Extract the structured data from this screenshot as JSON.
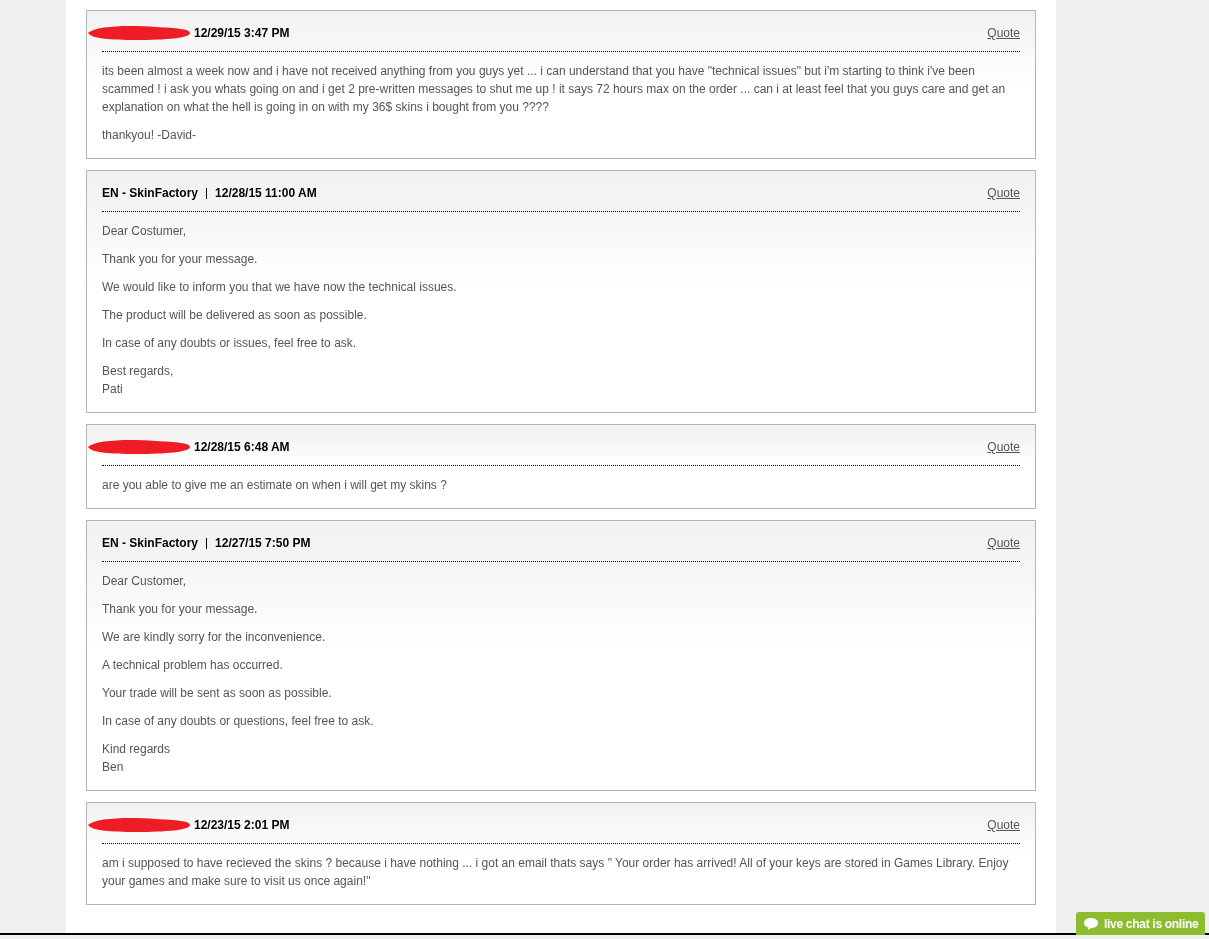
{
  "messages": [
    {
      "kind": "redacted",
      "date": "12/29/15 3:47 PM",
      "quote": "Quote",
      "paragraphs": [
        [
          "its been almost a week now and i have not received anything from you guys yet ... i can understand that you have \"technical issues\" but i'm starting to think i've been scammed ! i ask you whats going on and i get 2 pre-written messages to shut me up ! it says 72 hours max on the order ... can i at least feel that you guys care and get an explanation on what the hell is going in on with my 36$ skins i bought from you ????"
        ],
        [
          "thankyou! -David-"
        ]
      ]
    },
    {
      "kind": "staff",
      "author": "EN - SkinFactory",
      "date": "12/28/15 11:00 AM",
      "quote": "Quote",
      "paragraphs": [
        [
          "Dear Costumer,"
        ],
        [
          "Thank you for your message."
        ],
        [
          "We would like to inform you that we have now the technical issues."
        ],
        [
          "The product will be delivered as soon as possible."
        ],
        [
          "In case of any doubts or issues, feel free to ask."
        ],
        [
          "Best regards,",
          "Pati"
        ]
      ]
    },
    {
      "kind": "redacted",
      "date": "12/28/15 6:48 AM",
      "quote": "Quote",
      "paragraphs": [
        [
          "are you able to give me an estimate on when i will get my skins ?"
        ]
      ]
    },
    {
      "kind": "staff",
      "author": "EN - SkinFactory",
      "date": "12/27/15 7:50 PM",
      "quote": "Quote",
      "paragraphs": [
        [
          "Dear Customer,"
        ],
        [
          "Thank you for your message."
        ],
        [
          "We are kindly sorry for the inconvenience."
        ],
        [
          "A technical problem has occurred."
        ],
        [
          "Your trade will be sent as soon as possible."
        ],
        [
          "In case of any doubts or questions, feel free to ask."
        ],
        [
          "Kind regards",
          "Ben"
        ]
      ]
    },
    {
      "kind": "redacted",
      "date": "12/23/15 2:01 PM",
      "quote": "Quote",
      "paragraphs": [
        [
          "am i supposed to have recieved the skins ? because i have nothing ... i got an email thats says \" Your order has arrived! All of your keys are stored in Games Library. Enjoy your games and make sure to visit us once again!\""
        ]
      ]
    }
  ],
  "live_chat": {
    "label": "live chat is online"
  }
}
